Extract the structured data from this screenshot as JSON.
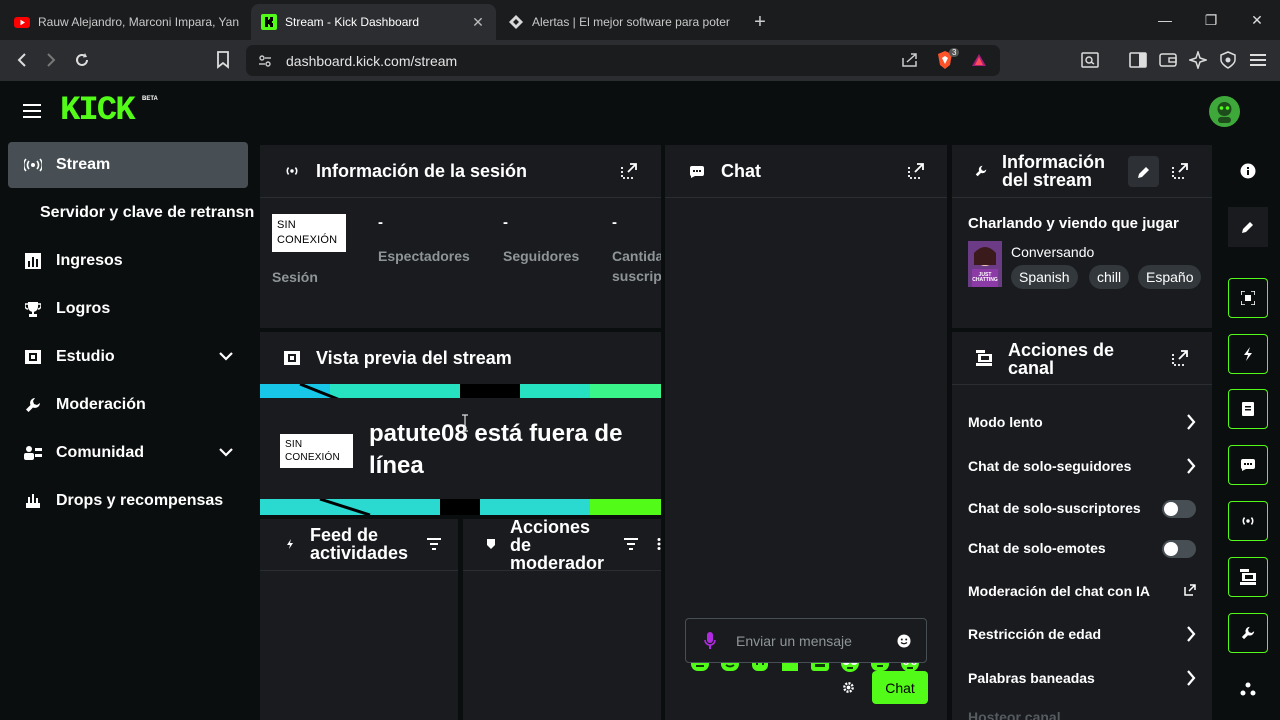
{
  "browser": {
    "tabs": [
      {
        "title": "Rauw Alejandro, Marconi Impara, Yan",
        "favicon": "youtube-icon"
      },
      {
        "title": "Stream - Kick Dashboard",
        "favicon": "kick-icon"
      },
      {
        "title": "Alertas | El mejor software para poter",
        "favicon": "streamlabs-icon"
      }
    ],
    "url": "dashboard.kick.com/stream",
    "brave_badge": "3"
  },
  "app": {
    "logo": "KICK",
    "logo_badge": "BETA"
  },
  "sidebar": {
    "items": [
      {
        "label": "Stream",
        "icon": "broadcast-icon"
      },
      {
        "label": "Servidor y clave de retransn",
        "icon": ""
      },
      {
        "label": "Ingresos",
        "icon": "chart-icon"
      },
      {
        "label": "Logros",
        "icon": "trophy-icon"
      },
      {
        "label": "Estudio",
        "icon": "studio-icon"
      },
      {
        "label": "Moderación",
        "icon": "wrench-icon"
      },
      {
        "label": "Comunidad",
        "icon": "community-icon"
      },
      {
        "label": "Drops y recompensas",
        "icon": "drops-icon"
      }
    ]
  },
  "session": {
    "title": "Información de la sesión",
    "badge": "SIN CONEXIÓN",
    "session_label": "Sesión",
    "stats": [
      {
        "value": "-",
        "label": "Espectadores"
      },
      {
        "value": "-",
        "label": "Seguidores"
      },
      {
        "value": "-",
        "label": "Cantida",
        "label2": "suscrip"
      }
    ]
  },
  "preview": {
    "title": "Vista previa del stream",
    "badge": "SIN CONEXIÓN",
    "offline_line1": "patute08 está fuera de",
    "offline_line2": "línea"
  },
  "feed": {
    "line1": "Feed de",
    "line2": "actividades"
  },
  "modactions": {
    "line1": "Acciones",
    "line2": "de",
    "line3": "moderador"
  },
  "chat": {
    "title": "Chat",
    "placeholder": "Enviar un mensaje",
    "send_label": "Chat"
  },
  "stream_info": {
    "title_line1": "Información",
    "title_line2": "del stream",
    "stream_title": "Charlando y viendo que jugar",
    "category": "Conversando",
    "category_thumb_text": "JUST CHATTING",
    "tags": [
      "Spanish",
      "chill",
      "Españo"
    ]
  },
  "channel_actions": {
    "title_line1": "Acciones de",
    "title_line2": "canal",
    "rows": [
      {
        "label": "Modo lento",
        "control": "arrow"
      },
      {
        "label": "Chat de solo-seguidores",
        "control": "arrow"
      },
      {
        "label": "Chat de solo-suscriptores",
        "control": "toggle"
      },
      {
        "label": "Chat de solo-emotes",
        "control": "toggle"
      },
      {
        "label": "Moderación del chat con IA",
        "control": "external"
      },
      {
        "label": "Restricción de edad",
        "control": "arrow"
      },
      {
        "label": "Palabras baneadas",
        "control": "arrow"
      }
    ],
    "cut_row": "Hosteor canal"
  },
  "colors": {
    "accent": "#53fc18",
    "panel": "#191b1f",
    "page": "#0b0e0f",
    "muted_text": "#8f9597"
  }
}
